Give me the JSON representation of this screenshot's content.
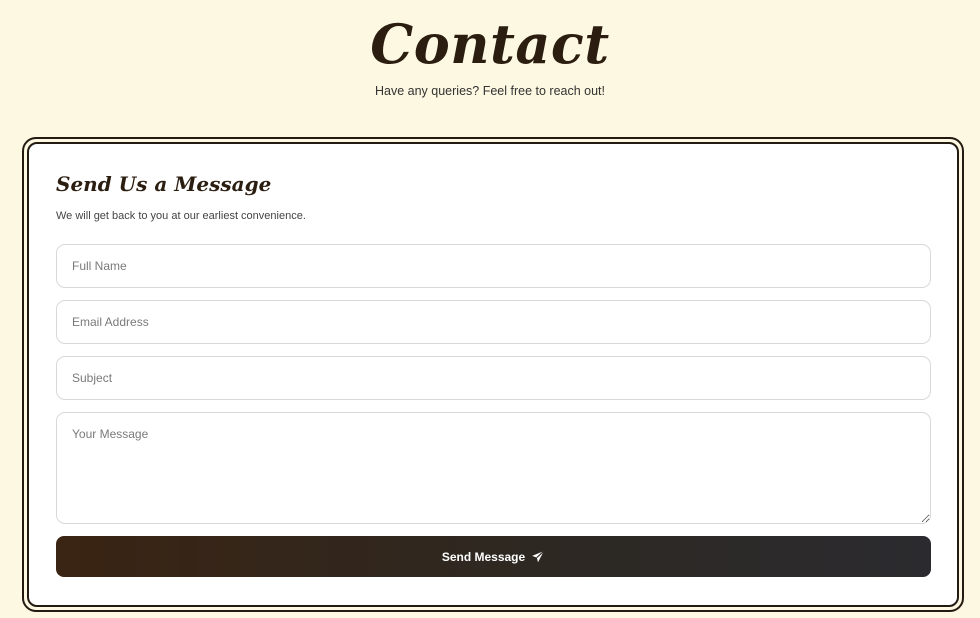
{
  "header": {
    "title": "Contact",
    "subtitle": "Have any queries? Feel free to reach out!"
  },
  "form": {
    "title": "Send Us a Message",
    "description": "We will get back to you at our earliest convenience.",
    "fields": {
      "name_placeholder": "Full Name",
      "email_placeholder": "Email Address",
      "subject_placeholder": "Subject",
      "message_placeholder": "Your Message"
    },
    "submit_label": "Send Message",
    "submit_icon": "paper-plane-icon"
  },
  "colors": {
    "background": "#fdf8e1",
    "accent_dark": "#2b1e10",
    "card": "#ffffff"
  }
}
